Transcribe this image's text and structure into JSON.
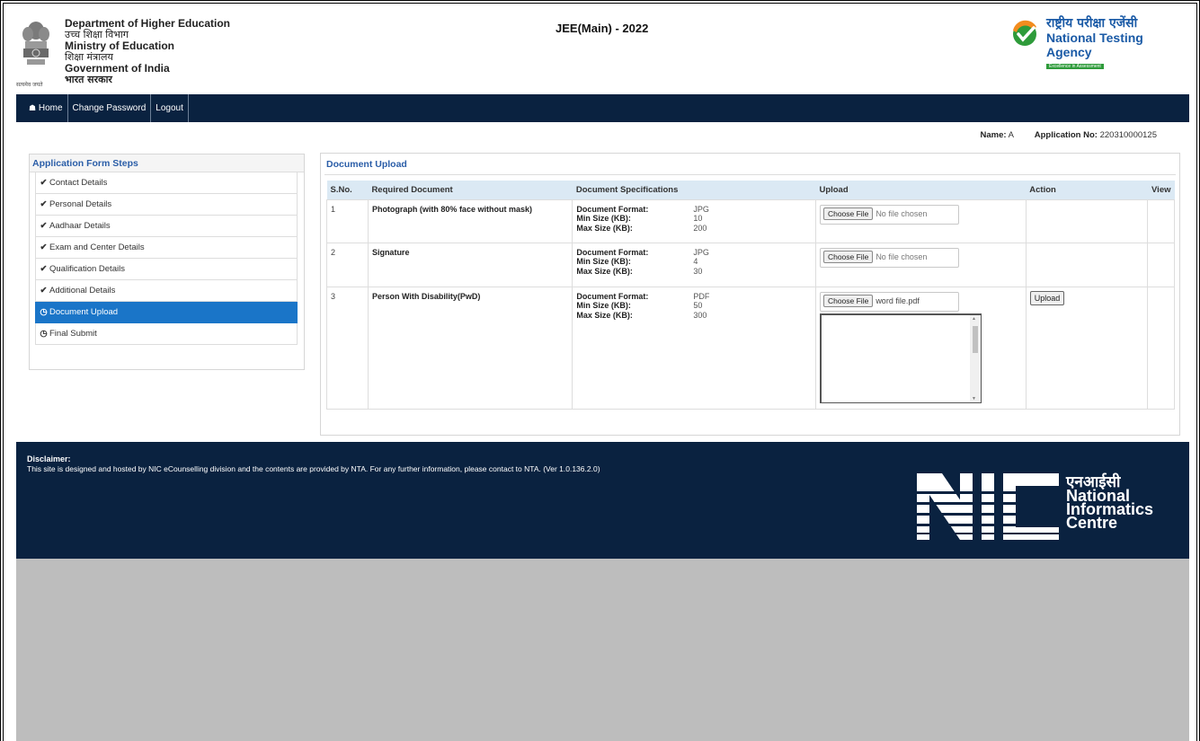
{
  "header": {
    "dept_en": "Department of Higher Education",
    "dept_hi": "उच्च शिक्षा विभाग",
    "ministry_en": "Ministry of Education",
    "ministry_hi": "शिक्षा मंत्रालय",
    "govt_en": "Government of India",
    "govt_hi": "भारत सरकार",
    "motto": "सत्यमेव जयते",
    "exam_title": "JEE(Main) - 2022",
    "nta_hi": "राष्ट्रीय परीक्षा एजेंसी",
    "nta_en": "National Testing Agency",
    "nta_tagline": "Excellence in Assessment",
    "emblem_icon": "state-emblem-icon",
    "nta_logo_icon": "nta-checkmark-logo-icon"
  },
  "nav": {
    "home_icon": "home-icon",
    "items": [
      "Home",
      "Change Password",
      "Logout"
    ]
  },
  "user": {
    "name_label": "Name:",
    "name_value": "A",
    "app_label": "Application No:",
    "app_value": "220310000125"
  },
  "steps": {
    "title": "Application Form Steps",
    "items": [
      {
        "label": "Contact Details",
        "icon": "check-circle-icon",
        "status": "done"
      },
      {
        "label": "Personal Details",
        "icon": "check-circle-icon",
        "status": "done"
      },
      {
        "label": "Aadhaar Details",
        "icon": "check-circle-icon",
        "status": "done"
      },
      {
        "label": "Exam and Center Details",
        "icon": "check-circle-icon",
        "status": "done"
      },
      {
        "label": "Qualification Details",
        "icon": "check-circle-icon",
        "status": "done"
      },
      {
        "label": "Additional Details",
        "icon": "check-circle-icon",
        "status": "done"
      },
      {
        "label": "Document Upload",
        "icon": "clock-icon",
        "status": "active"
      },
      {
        "label": "Final Submit",
        "icon": "clock-icon",
        "status": "pending"
      }
    ]
  },
  "docs": {
    "title": "Document Upload",
    "columns": [
      "S.No.",
      "Required Document",
      "Document Specifications",
      "Upload",
      "Action",
      "View"
    ],
    "spec_labels": {
      "format": "Document Format:",
      "min": "Min Size (KB):",
      "max": "Max Size (KB):"
    },
    "choose_file_label": "Choose File",
    "upload_btn_label": "Upload",
    "rows": [
      {
        "sno": "1",
        "doc": "Photograph (with 80% face without mask)",
        "format": "JPG",
        "min": "10",
        "max": "200",
        "file": "No file chosen"
      },
      {
        "sno": "2",
        "doc": "Signature",
        "format": "JPG",
        "min": "4",
        "max": "30",
        "file": "No file chosen"
      },
      {
        "sno": "3",
        "doc": "Person With Disability(PwD)",
        "format": "PDF",
        "min": "50",
        "max": "300",
        "file": "word file.pdf"
      }
    ]
  },
  "footer": {
    "disclaimer_title": "Disclaimer:",
    "disclaimer_text": "This site is designed and hosted by NIC eCounselling division and the contents are provided by NTA. For any further information, please contact to NTA. (Ver 1.0.136.2.0)",
    "nic_hi": "एनआईसी",
    "nic_line1": "National",
    "nic_line2": "Informatics",
    "nic_line3": "Centre",
    "nic_logo_icon": "nic-logo-icon"
  },
  "colors": {
    "navy": "#0a2240",
    "accent_blue": "#2b5ea8",
    "active_step": "#1a75c8",
    "table_header": "#dbe9f4",
    "nta_green": "#2e9b3a",
    "nta_orange": "#f28c1e",
    "footer_grey": "#bdbdbd"
  }
}
